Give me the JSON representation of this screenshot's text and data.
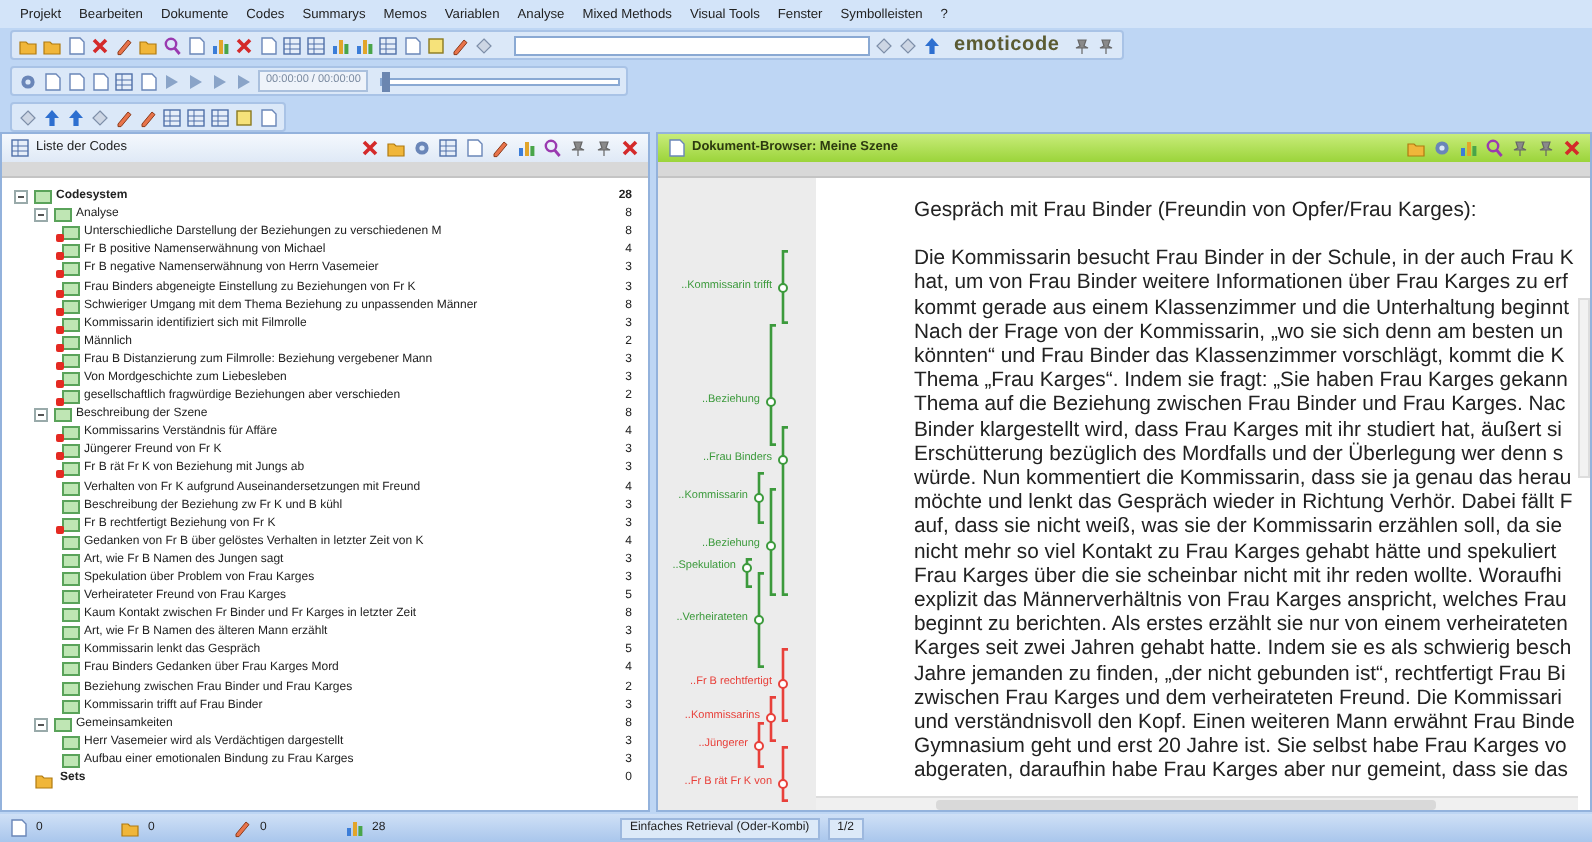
{
  "menu": [
    "Projekt",
    "Bearbeiten",
    "Dokumente",
    "Codes",
    "Summarys",
    "Memos",
    "Variablen",
    "Analyse",
    "Mixed Methods",
    "Visual Tools",
    "Fenster",
    "Symbolleisten",
    "?"
  ],
  "toolbar": {
    "logo": "emoticode",
    "time": "00:00:00 / 00:00:00",
    "seek": {
      "level": 0
    }
  },
  "code_panel": {
    "title": "Liste der Codes",
    "tree": [
      {
        "kind": "root",
        "label": "Codesystem",
        "count": "28",
        "expanded": true,
        "children": [
          {
            "kind": "code",
            "label": "Analyse",
            "count": "8",
            "expanded": true,
            "children": [
              {
                "kind": "code",
                "label": "Unterschiedliche Darstellung der Beziehungen zu verschiedenen M",
                "count": "8",
                "memo": true
              },
              {
                "kind": "code",
                "label": "Fr B positive Namenserwähnung von Michael",
                "count": "4",
                "memo": true
              },
              {
                "kind": "code",
                "label": "Fr B negative Namenserwähnung von Herrn Vasemeier",
                "count": "3",
                "memo": true
              },
              {
                "kind": "code",
                "label": "Frau Binders abgeneigte Einstellung zu Beziehungen von Fr K",
                "count": "3",
                "memo": true
              },
              {
                "kind": "code",
                "label": "Schwieriger Umgang mit dem Thema Beziehung zu unpassenden Männer",
                "count": "8",
                "memo": true
              },
              {
                "kind": "code",
                "label": "Kommissarin identifiziert sich mit Filmrolle",
                "count": "3",
                "memo": true
              },
              {
                "kind": "code",
                "label": "Männlich",
                "count": "2",
                "memo": true
              },
              {
                "kind": "code",
                "label": "Frau B Distanzierung zum Filmrolle: Beziehung vergebener Mann",
                "count": "3",
                "memo": true
              },
              {
                "kind": "code",
                "label": "Von Mordgeschichte zum Liebesleben",
                "count": "3",
                "memo": true
              },
              {
                "kind": "code",
                "label": "gesellschaftlich fragwürdige Beziehungen aber verschieden",
                "count": "2",
                "memo": true
              }
            ]
          },
          {
            "kind": "code",
            "label": "Beschreibung der Szene",
            "count": "8",
            "expanded": true,
            "children": [
              {
                "kind": "code",
                "label": "Kommissarins Verständnis für Affäre",
                "count": "4",
                "memo": true
              },
              {
                "kind": "code",
                "label": "Jüngerer Freund von Fr K",
                "count": "3",
                "memo": true
              },
              {
                "kind": "code",
                "label": "Fr B rät Fr K von Beziehung mit Jungs ab",
                "count": "3",
                "memo": true
              },
              {
                "kind": "code",
                "label": "Verhalten von Fr K aufgrund Auseinandersetzungen mit Freund",
                "count": "4",
                "memo": false
              },
              {
                "kind": "code",
                "label": "Beschreibung der Beziehung zw Fr K und B kühl",
                "count": "3",
                "memo": false
              },
              {
                "kind": "code",
                "label": "Fr B rechtfertigt Beziehung von Fr K",
                "count": "3",
                "memo": true
              },
              {
                "kind": "code",
                "label": "Gedanken von Fr B über gelöstes Verhalten in letzter Zeit von K",
                "count": "4",
                "memo": false
              },
              {
                "kind": "code",
                "label": "Art, wie Fr B Namen des Jungen sagt",
                "count": "3",
                "memo": false
              },
              {
                "kind": "code",
                "label": "Spekulation über Problem von Frau Karges",
                "count": "3",
                "memo": false
              },
              {
                "kind": "code",
                "label": "Verheirateter Freund von Frau Karges",
                "count": "5",
                "memo": false
              },
              {
                "kind": "code",
                "label": "Kaum Kontakt zwischen Fr Binder und Fr Karges in letzter Zeit",
                "count": "8",
                "memo": false
              },
              {
                "kind": "code",
                "label": "Art, wie Fr B Namen des älteren Mann erzählt",
                "count": "3",
                "memo": false
              },
              {
                "kind": "code",
                "label": "Kommissarin lenkt das Gespräch",
                "count": "5",
                "memo": false
              },
              {
                "kind": "code",
                "label": "Frau Binders Gedanken über Frau Karges Mord",
                "count": "4",
                "memo": false
              },
              {
                "kind": "code",
                "label": "Beziehung zwischen Frau Binder und Frau Karges",
                "count": "2",
                "memo": false
              },
              {
                "kind": "code",
                "label": "Kommissarin trifft auf Frau Binder",
                "count": "3",
                "memo": false
              }
            ]
          },
          {
            "kind": "code",
            "label": "Gemeinsamkeiten",
            "count": "8",
            "expanded": true,
            "children": [
              {
                "kind": "code",
                "label": "Herr Vasemeier wird als Verdächtigen dargestellt",
                "count": "3",
                "memo": false
              },
              {
                "kind": "code",
                "label": "Aufbau einer emotionalen Bindung zu Frau Karges",
                "count": "3",
                "memo": false
              }
            ]
          }
        ]
      },
      {
        "kind": "set",
        "label": "Sets",
        "count": "0"
      }
    ]
  },
  "document_panel": {
    "title": "Dokument-Browser: Meine Szene",
    "coding_stripes": [
      {
        "label": "..Kommissarin trifft",
        "color": "#3c9a3c"
      },
      {
        "label": "..Beziehung",
        "color": "#3c9a3c"
      },
      {
        "label": "..Frau Binders",
        "color": "#3c9a3c"
      },
      {
        "label": "..Kommissarin",
        "color": "#3c9a3c"
      },
      {
        "label": "..Beziehung",
        "color": "#3c9a3c"
      },
      {
        "label": "..Spekulation",
        "color": "#3c9a3c"
      },
      {
        "label": "..Verheirateten",
        "color": "#3c9a3c"
      },
      {
        "label": "..Fr B rechtfertigt",
        "color": "#e8403a"
      },
      {
        "label": "..Kommissarins",
        "color": "#e8403a"
      },
      {
        "label": "..Jüngerer",
        "color": "#e8403a"
      },
      {
        "label": "..Fr B rät Fr K von",
        "color": "#e8403a"
      }
    ],
    "heading": "Gespräch mit Frau Binder (Freundin von Opfer/Frau Karges):",
    "lines": [
      "Die Kommissarin besucht Frau Binder in der Schule, in der auch Frau K",
      "hat, um von Frau Binder weitere Informationen über Frau Karges zu erf",
      "kommt gerade aus einem Klassenzimmer und die Unterhaltung beginnt",
      "Nach der Frage von der Kommissarin, „wo sie sich denn am besten un",
      "könnten“ und Frau Binder das Klassenzimmer vorschlägt, kommt die K",
      "Thema „Frau Karges“. Indem sie fragt: „Sie haben Frau Karges gekann",
      "Thema auf die Beziehung zwischen Frau Binder und Frau Karges. Nac",
      "Binder klargestellt wird, dass Frau Karges mit ihr studiert hat, äußert si",
      "Erschütterung bezüglich des Mordfalls und der Überlegung wer denn s",
      "würde. Nun kommentiert die Kommissarin, dass sie ja genau das herau",
      "möchte und lenkt das Gespräch wieder in Richtung Verhör. Dabei fällt F",
      "auf, dass sie nicht weiß, was sie der Kommissarin erzählen soll, da sie",
      "nicht mehr so viel Kontakt zu Frau Karges gehabt hätte und spekuliert",
      "Frau Karges über die sie scheinbar nicht mit ihr reden wollte. Woraufhi",
      "explizit das Männerverhältnis von Frau Karges anspricht, welches Frau",
      "beginnt zu berichten. Als erstes erzählt sie nur von einem verheirateten",
      "Karges seit zwei Jahren gehabt hatte. Indem sie es als schwierig besch",
      "Jahre jemanden zu finden, „der nicht gebunden ist“, rechtfertigt Frau Bi",
      "zwischen Frau Karges und dem verheirateten Freund. Die Kommissari",
      "und verständnisvoll den Kopf. Einen weiteren Mann erwähnt Frau Binde",
      "Gymnasium geht und erst 20 Jahre ist. Sie selbst habe Frau Karges vo",
      "abgeraten, daraufhin habe Frau Karges aber nur gemeint, dass sie das"
    ]
  },
  "status_bar": {
    "counts": [
      "0",
      "0",
      "0",
      "28"
    ],
    "retrieval": "Einfaches Retrieval (Oder-Kombi)",
    "page": "1/2"
  }
}
